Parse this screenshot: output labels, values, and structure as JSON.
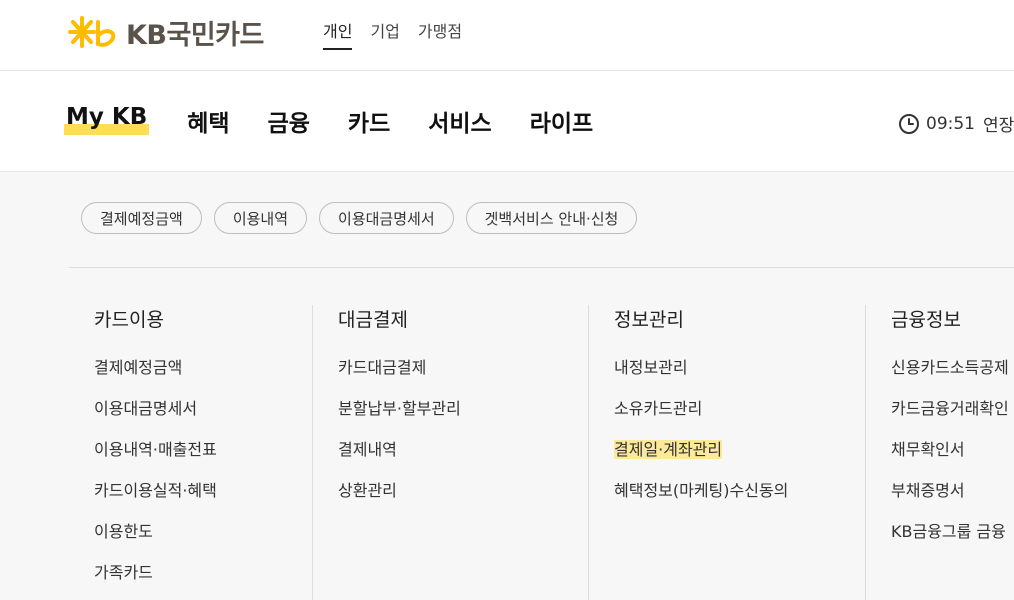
{
  "brand": {
    "name": "KB국민카드",
    "accent": "#ffbc00"
  },
  "segments": [
    {
      "label": "개인",
      "active": true
    },
    {
      "label": "기업",
      "active": false
    },
    {
      "label": "가맹점",
      "active": false
    }
  ],
  "gnb": [
    {
      "label": "My KB",
      "active": true
    },
    {
      "label": "혜택",
      "active": false
    },
    {
      "label": "금융",
      "active": false
    },
    {
      "label": "카드",
      "active": false
    },
    {
      "label": "서비스",
      "active": false
    },
    {
      "label": "라이프",
      "active": false
    }
  ],
  "session": {
    "time": "09:51",
    "extend_label": "연장"
  },
  "chips": [
    "결제예정금액",
    "이용내역",
    "이용대금명세서",
    "겟백서비스 안내·신청"
  ],
  "columns": [
    {
      "title": "카드이용",
      "items": [
        "결제예정금액",
        "이용대금명세서",
        "이용내역·매출전표",
        "카드이용실적·혜택",
        "이용한도",
        "가족카드"
      ]
    },
    {
      "title": "대금결제",
      "items": [
        "카드대금결제",
        "분할납부·할부관리",
        "결제내역",
        "상환관리"
      ]
    },
    {
      "title": "정보관리",
      "items": [
        "내정보관리",
        "소유카드관리",
        "결제일·계좌관리",
        "혜택정보(마케팅)수신동의"
      ]
    },
    {
      "title": "금융정보",
      "items": [
        "신용카드소득공제",
        "카드금융거래확인",
        "채무확인서",
        "부채증명서",
        "KB금융그룹 금융"
      ]
    }
  ]
}
